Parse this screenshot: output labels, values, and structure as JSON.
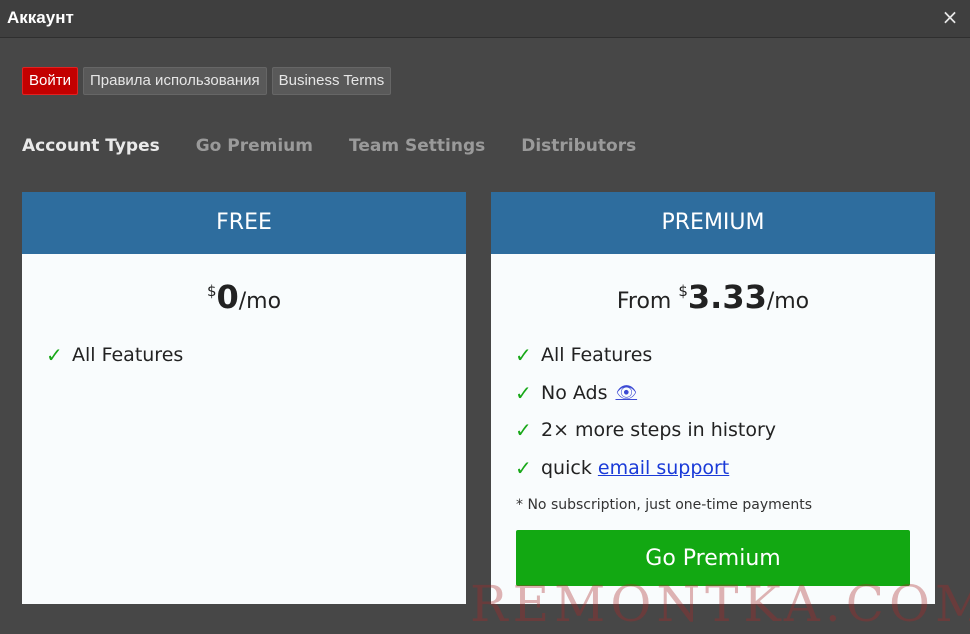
{
  "window": {
    "title": "Аккаунт",
    "close_icon": "close-icon",
    "close_glyph": "×"
  },
  "buttons": {
    "login": "Войти",
    "terms": "Правила использования",
    "business": "Business Terms"
  },
  "tabs": [
    {
      "label": "Account Types",
      "active": true
    },
    {
      "label": "Go Premium",
      "active": false
    },
    {
      "label": "Team Settings",
      "active": false
    },
    {
      "label": "Distributors",
      "active": false
    }
  ],
  "free_plan": {
    "title": "FREE",
    "currency": "$",
    "price": "0",
    "per": "/mo",
    "features": [
      "All Features"
    ]
  },
  "premium_plan": {
    "title": "PREMIUM",
    "from": "From ",
    "currency": "$",
    "price": "3.33",
    "per": "/mo",
    "features": {
      "all": "All Features",
      "ads": "No Ads",
      "ads_icon": "eye-icon",
      "ads_glyph": "👁",
      "steps": "2× more steps in history",
      "support_prefix": "quick ",
      "support_link": "email support"
    },
    "note": "* No subscription, just one-time payments",
    "cta": "Go Premium"
  },
  "check_glyph": "✓",
  "watermark": "REMONTKA.COM",
  "colors": {
    "background": "#474747",
    "card_header": "#2e6d9e",
    "login_button": "#c30000",
    "cta_button": "#12a812",
    "check": "#18a818",
    "link": "#1a3ad8"
  }
}
